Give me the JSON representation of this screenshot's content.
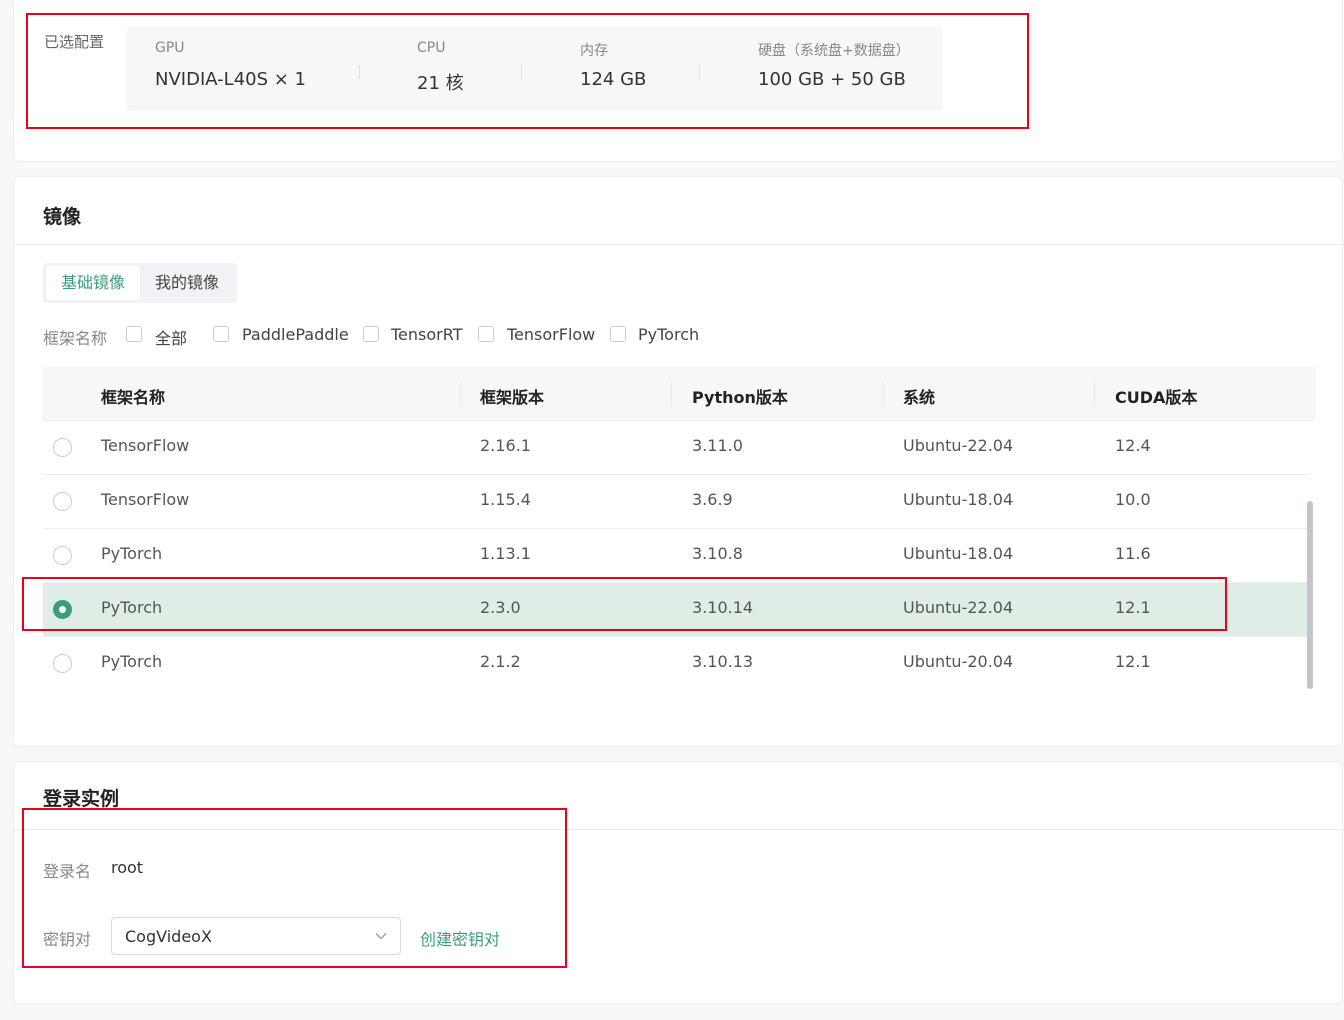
{
  "selected_config": {
    "label": "已选配置",
    "items": [
      {
        "key": "GPU",
        "value": "NVIDIA-L40S × 1"
      },
      {
        "key": "CPU",
        "value": "21 核"
      },
      {
        "key": "内存",
        "value": "124 GB"
      },
      {
        "key": "硬盘（系统盘+数据盘）",
        "value": "100 GB + 50 GB"
      }
    ]
  },
  "image": {
    "title": "镜像",
    "tabs": [
      {
        "label": "基础镜像",
        "active": true
      },
      {
        "label": "我的镜像",
        "active": false
      }
    ],
    "filter": {
      "label": "框架名称",
      "options": [
        "全部",
        "PaddlePaddle",
        "TensorRT",
        "TensorFlow",
        "PyTorch"
      ]
    },
    "table": {
      "columns": [
        "框架名称",
        "框架版本",
        "Python版本",
        "系统",
        "CUDA版本"
      ],
      "rows": [
        {
          "framework": "TensorFlow",
          "version": "2.16.1",
          "python": "3.11.0",
          "os": "Ubuntu-22.04",
          "cuda": "12.4",
          "selected": false
        },
        {
          "framework": "TensorFlow",
          "version": "1.15.4",
          "python": "3.6.9",
          "os": "Ubuntu-18.04",
          "cuda": "10.0",
          "selected": false
        },
        {
          "framework": "PyTorch",
          "version": "1.13.1",
          "python": "3.10.8",
          "os": "Ubuntu-18.04",
          "cuda": "11.6",
          "selected": false
        },
        {
          "framework": "PyTorch",
          "version": "2.3.0",
          "python": "3.10.14",
          "os": "Ubuntu-22.04",
          "cuda": "12.1",
          "selected": true
        },
        {
          "framework": "PyTorch",
          "version": "2.1.2",
          "python": "3.10.13",
          "os": "Ubuntu-20.04",
          "cuda": "12.1",
          "selected": false
        }
      ]
    }
  },
  "login": {
    "title": "登录实例",
    "username_label": "登录名",
    "username": "root",
    "keypair_label": "密钥对",
    "keypair_value": "CogVideoX",
    "create_keypair_link": "创建密钥对"
  },
  "colors": {
    "accent": "#3b9e7b",
    "selected_row": "#deede6",
    "highlight_box": "#e8001c"
  }
}
